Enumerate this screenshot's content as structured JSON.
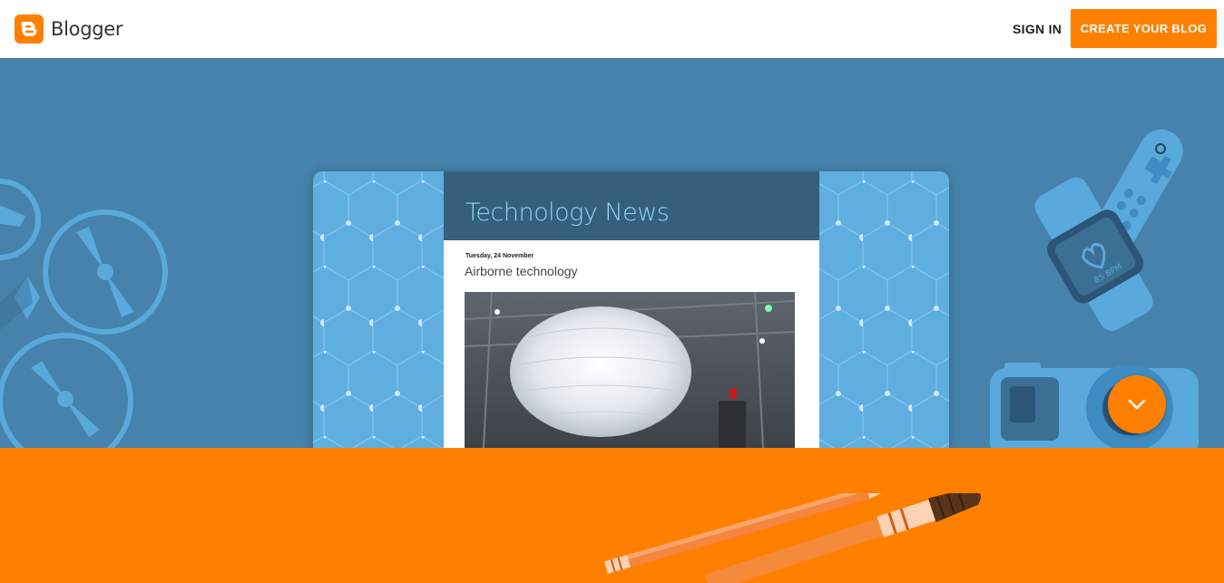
{
  "header": {
    "brand": "Blogger",
    "sign_in_label": "SIGN IN",
    "create_blog_label": "CREATE YOUR BLOG"
  },
  "hero": {
    "mockup": {
      "blog_title": "Technology News",
      "post_date": "Tuesday, 24 November",
      "post_title": "Airborne technology"
    },
    "watch_text": "85 BPM"
  },
  "colors": {
    "brand_orange": "#ff8000",
    "hero_blue": "#4682ab",
    "mockup_blue": "#5faee0",
    "blog_header": "#355f7b"
  },
  "icons": {
    "logo": "blogger-logo-icon",
    "scroll": "chevron-down-icon"
  }
}
